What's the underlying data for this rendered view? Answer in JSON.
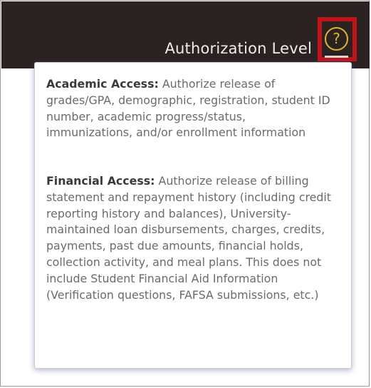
{
  "header": {
    "title": "Authorization Level",
    "help_glyph": "?",
    "help_icon": "question-circle-icon",
    "help_color": "#e0b728",
    "highlight_color": "#c3131a",
    "background_color": "#2b2322"
  },
  "tooltip": {
    "academic": {
      "term": "Academic Access:",
      "text": "Authorize release of grades/GPA, demographic, registration, student ID number, academic progress/status, immunizations, and/or enrollment information"
    },
    "financial": {
      "term": "Financial Access:",
      "text": "Authorize release of billing statement and repayment history (including credit reporting history and balances), University-maintained loan disbursements, charges, credits, payments, past due amounts, financial holds, collection activity, and meal plans. This does not include Student Financial Aid Information (Verification questions, FAFSA submissions, etc.)"
    }
  }
}
